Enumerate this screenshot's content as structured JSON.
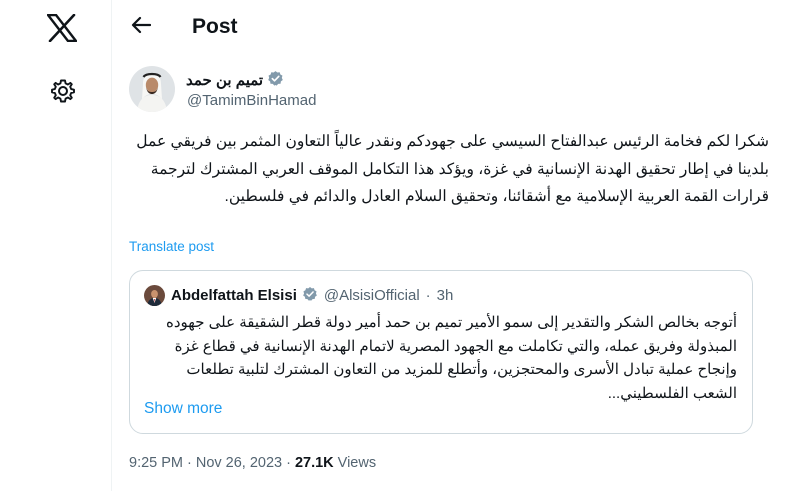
{
  "header": {
    "title": "Post",
    "back_label": "Back"
  },
  "post": {
    "author_name": "تميم بن حمد",
    "author_handle": "@TamimBinHamad",
    "text": "شكرا لكم فخامة الرئيس عبدالفتاح السيسي على جهودكم ونقدر عالياً التعاون المثمر بين فريقي عمل بلدينا في إطار تحقيق الهدنة الإنسانية في غزة، ويؤكد هذا التكامل الموقف العربي المشترك لترجمة قرارات القمة العربية الإسلامية مع أشقائنا، وتحقيق السلام العادل والدائم في فلسطين.",
    "translate_label": "Translate post",
    "time": "9:25 PM",
    "date": "Nov 26, 2023",
    "views_count": "27.1K",
    "views_label": "Views",
    "separator": "·"
  },
  "quote": {
    "name": "Abdelfattah Elsisi",
    "handle": "@AlsisiOfficial",
    "separator": "·",
    "age": "3h",
    "text": "أتوجه بخالص الشكر والتقدير إلى سمو الأمير تميم بن حمد أمير دولة قطر الشقيقة على جهوده المبذولة وفريق عمله، والتي تكاملت مع الجهود المصرية لاتمام الهدنة الإنسانية في قطاع غزة وإنجاح عملية تبادل الأسرى والمحتجزين، وأتطلع للمزيد من التعاون المشترك لتلبية تطلعات الشعب الفلسطيني...",
    "show_more_label": "Show more"
  },
  "colors": {
    "accent": "#1d9bf0",
    "secondary_text": "#536471",
    "border": "#cfd9de",
    "verified_badge": "#829aab"
  },
  "icons": {
    "logo": "x-logo-icon",
    "settings": "gear-icon",
    "back": "arrow-left-icon",
    "verified": "verified-badge-icon"
  }
}
